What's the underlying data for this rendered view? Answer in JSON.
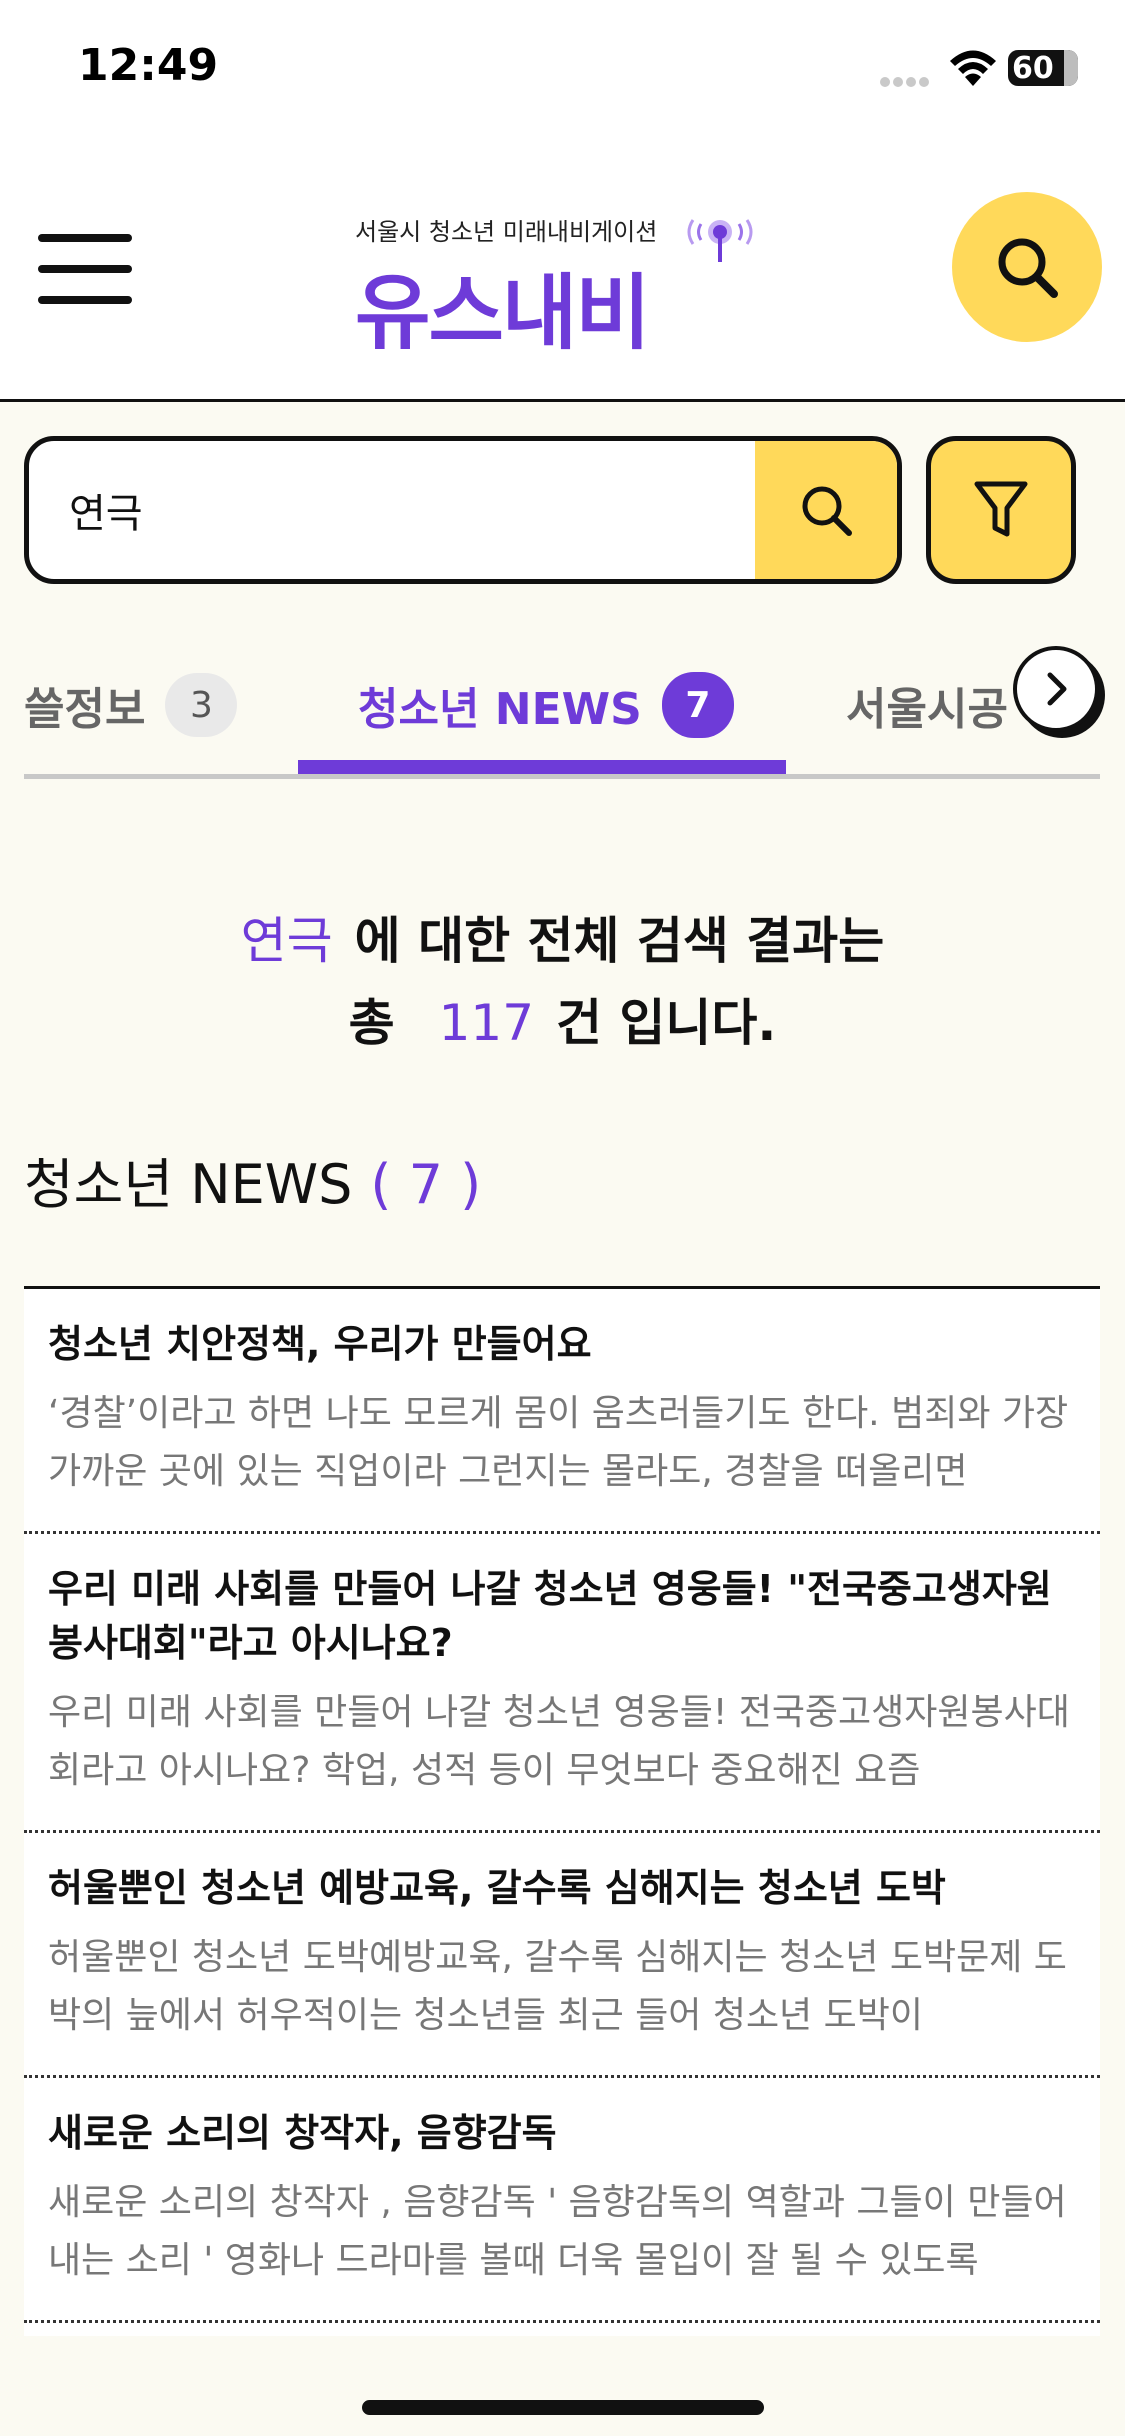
{
  "status_bar": {
    "time": "12:49",
    "battery": "60"
  },
  "header": {
    "logo_subtitle": "서울시 청소년 미래내비게이션",
    "logo_title": "유스내비"
  },
  "search": {
    "value": "연극",
    "placeholder": ""
  },
  "tabs": [
    {
      "label": "쓸정보",
      "count": "3"
    },
    {
      "label": "청소년 NEWS",
      "count": "7"
    },
    {
      "label": "서울시공"
    }
  ],
  "summary": {
    "keyword": "연극",
    "line1_suffix": "에 대한 전체 검색 결과는",
    "prefix": "총",
    "total": "117",
    "suffix": "건 입니다."
  },
  "section": {
    "title": "청소년 NEWS",
    "count": "( 7 )"
  },
  "news": [
    {
      "title": "청소년 치안정책, 우리가 만들어요",
      "desc": "‘경찰’이라고 하면 나도 모르게 몸이 움츠러들기도 한다. 범죄와 가장 가까운 곳에 있는 직업이라 그런지는 몰라도, 경찰을 떠올리면"
    },
    {
      "title": "우리 미래 사회를 만들어 나갈 청소년 영웅들! \"전국중고생자원봉사대회\"라고 아시나요?",
      "desc": "우리 미래 사회를 만들어 나갈 청소년 영웅들! 전국중고생자원봉사대회라고 아시나요? 학업, 성적 등이 무엇보다 중요해진 요즘"
    },
    {
      "title": "허울뿐인 청소년 예방교육, 갈수록 심해지는 청소년 도박",
      "desc": "허울뿐인 청소년 도박예방교육, 갈수록 심해지는 청소년 도박문제 도박의 늪에서 허우적이는 청소년들 최근 들어 청소년 도박이"
    },
    {
      "title": "새로운 소리의 창작자, 음향감독",
      "desc": "새로운 소리의 창작자 , 음향감독 ' 음향감독의 역할과 그들이 만들어 내는 소리 ' 영화나 드라마를 볼때 더욱 몰입이 잘 될 수 있도록"
    }
  ],
  "colors": {
    "accent": "#6e3bd8",
    "highlight": "#ffd95a",
    "background": "#fbfaf2"
  }
}
